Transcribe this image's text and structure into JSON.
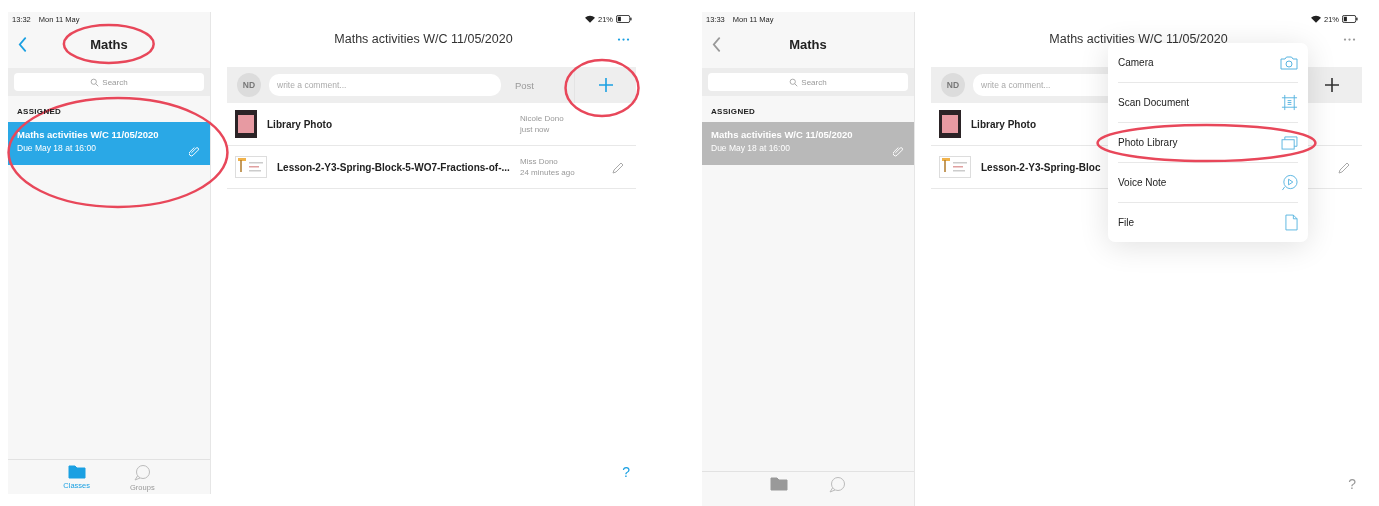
{
  "screens": [
    {
      "status": {
        "time": "13:32",
        "date": "Mon 11 May",
        "battery": "21%"
      },
      "dimmed": false,
      "sidebar": {
        "title": "Maths",
        "title_marked": true,
        "search_placeholder": "Search",
        "section": "ASSIGNED",
        "items": [
          {
            "title": "Maths activities W/C 11/05/2020",
            "due": "Due May 18 at 16:00",
            "selected": true,
            "marked": true
          }
        ],
        "tabs": [
          {
            "kind": "classes",
            "label": "Classes",
            "selected": true
          },
          {
            "kind": "groups",
            "label": "Groups",
            "selected": false
          }
        ]
      },
      "detail": {
        "title": "Maths activities W/C 11/05/2020",
        "comment": {
          "avatar": "ND",
          "placeholder": "write a comment...",
          "post": "Post"
        },
        "add_marked": true,
        "posts": [
          {
            "kind": "photo",
            "name": "Library Photo",
            "author": "Nicole Dono",
            "time": "just now",
            "editable": false
          },
          {
            "kind": "document",
            "name": "Lesson-2-Y3-Spring-Block-5-WO7-Fractions-of-...",
            "author": "Miss Dono",
            "time": "24 minutes ago",
            "editable": true
          }
        ],
        "help": "?"
      }
    },
    {
      "status": {
        "time": "13:33",
        "date": "Mon 11 May",
        "battery": "21%"
      },
      "dimmed": true,
      "sidebar": {
        "title": "Maths",
        "title_marked": false,
        "search_placeholder": "Search",
        "section": "ASSIGNED",
        "items": [
          {
            "title": "Maths activities W/C 11/05/2020",
            "due": "Due May 18 at 16:00",
            "selected": true,
            "marked": false
          }
        ],
        "tabs": [
          {
            "kind": "classes",
            "selected": true
          },
          {
            "kind": "groups",
            "selected": false
          }
        ]
      },
      "detail": {
        "title": "Maths activities W/C 11/05/2020",
        "comment": {
          "avatar": "ND",
          "placeholder": "write a comment..."
        },
        "add_marked": false,
        "posts": [
          {
            "kind": "photo",
            "name": "Library Photo",
            "editable": false
          },
          {
            "kind": "document",
            "name": "Lesson-2-Y3-Spring-Bloc",
            "editable": true
          }
        ],
        "help": "?",
        "menu": [
          {
            "kind": "camera",
            "label": "Camera",
            "marked": false
          },
          {
            "kind": "scan",
            "label": "Scan Document",
            "marked": false
          },
          {
            "kind": "photos",
            "label": "Photo Library",
            "marked": true
          },
          {
            "kind": "voice",
            "label": "Voice Note",
            "marked": false
          },
          {
            "kind": "file",
            "label": "File",
            "marked": false
          }
        ]
      }
    }
  ]
}
